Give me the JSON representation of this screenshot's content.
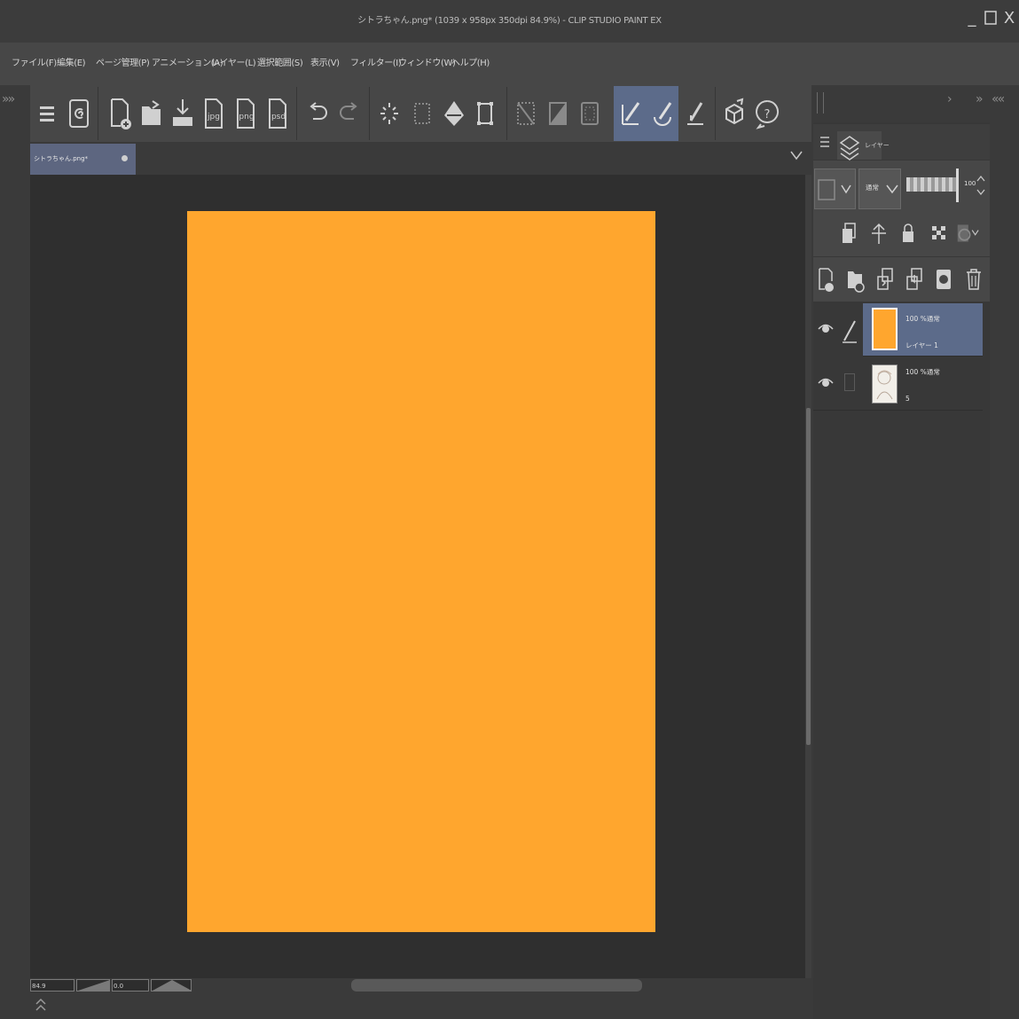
{
  "window": {
    "title": "シトラちゃん.png* (1039 x 958px 350dpi 84.9%)  - CLIP STUDIO PAINT EX",
    "minimize_glyph": "_",
    "maximize_glyph": "☐",
    "close_glyph": "X"
  },
  "menu": {
    "items": [
      {
        "label": "ファイル(F)"
      },
      {
        "label": "編集(E)"
      },
      {
        "label": "ページ管理(P)"
      },
      {
        "label": "アニメーション(A)"
      },
      {
        "label": "レイヤー(L)"
      },
      {
        "label": "選択範囲(S)"
      },
      {
        "label": "表示(V)"
      },
      {
        "label": "フィルター(I)"
      },
      {
        "label": "ウィンドウ(W)"
      },
      {
        "label": "ヘルプ(H)"
      }
    ]
  },
  "toolbar": {
    "icons": [
      "menu-icon",
      "clip-studio-icon",
      "new-file-icon",
      "open-folder-icon",
      "save-icon",
      "export-jpg-icon",
      "export-png-icon",
      "export-psd-icon",
      "undo-icon",
      "redo-icon",
      "loading-icon",
      "transform-icon",
      "fill-icon",
      "canvas-resize-icon",
      "select-none-icon",
      "invert-selection-icon",
      "selection-frame-icon",
      "pen-correction-icon",
      "brush-correction-icon",
      "ruler-snap-icon",
      "3d-icon",
      "help-icon"
    ],
    "jpg_label": "jpg",
    "png_label": "png",
    "psd_label": "psd"
  },
  "document_tab": {
    "label": "シトラちゃん.png*"
  },
  "status": {
    "zoom": "84.9",
    "rotation": "0.0"
  },
  "canvas": {
    "paper_color": "#ffa62e"
  },
  "layer_panel": {
    "tab_label": "レイヤー",
    "blend_mode": "通常",
    "opacity": "100",
    "layers": [
      {
        "info": "100 %通常",
        "name": "レイヤー 1",
        "selected": true
      },
      {
        "info": "100 %通常",
        "name": "5",
        "selected": false
      }
    ]
  },
  "colors": {
    "accent": "#5c6b8a",
    "paper": "#ffa62e",
    "background": "#2f2f2f"
  }
}
